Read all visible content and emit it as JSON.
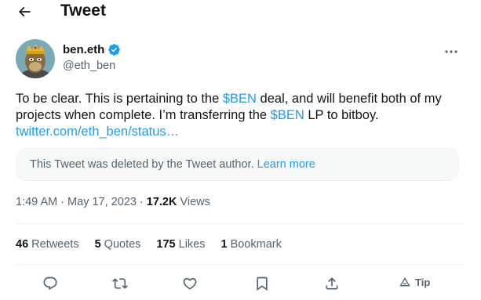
{
  "header": {
    "title": "Tweet"
  },
  "author": {
    "display_name": "ben.eth",
    "handle": "@eth_ben",
    "verified": true
  },
  "tweet": {
    "text_part1": "To be clear. This is pertaining to the ",
    "cashtag1": "$BEN",
    "text_part2": " deal, and will benefit both of my projects when complete. I’m transferring the ",
    "cashtag2": "$BEN",
    "text_part3": " LP to bitboy.",
    "link": "twitter.com/eth_ben/status…"
  },
  "quoted_notice": {
    "text": "This Tweet was deleted by the Tweet author.",
    "learn_more": "Learn more"
  },
  "meta": {
    "time": "1:49 AM",
    "separator": "·",
    "date": "May 17, 2023",
    "views_count": "17.2K",
    "views_label": "Views"
  },
  "stats": {
    "retweets": {
      "count": "46",
      "label": "Retweets"
    },
    "quotes": {
      "count": "5",
      "label": "Quotes"
    },
    "likes": {
      "count": "175",
      "label": "Likes"
    },
    "bookmarks": {
      "count": "1",
      "label": "Bookmark"
    }
  },
  "actions": {
    "tip_label": "Tip",
    "icons": [
      "reply-icon",
      "retweet-icon",
      "like-icon",
      "bookmark-icon",
      "share-icon",
      "tip-icon"
    ]
  },
  "colors": {
    "accent": "#1d9bf0",
    "text_primary": "#0f1419",
    "text_secondary": "#536471",
    "divider": "#eff3f4"
  }
}
